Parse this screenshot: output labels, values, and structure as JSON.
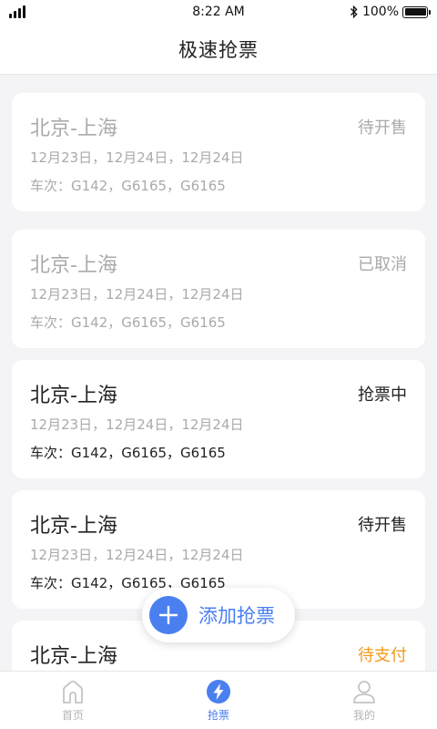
{
  "statusbar": {
    "time": "8:22 AM",
    "battery": "100%"
  },
  "header": {
    "title": "极速抢票"
  },
  "tickets": [
    {
      "route": "北京-上海",
      "status": "待开售",
      "dates": "12月23日，12月24日，12月24日",
      "trains": "车次：G142，G6165，G6165"
    },
    {
      "route": "北京-上海",
      "status": "已取消",
      "dates": "12月23日，12月24日，12月24日",
      "trains": "车次：G142，G6165，G6165"
    },
    {
      "route": "北京-上海",
      "status": "抢票中",
      "dates": "12月23日，12月24日，12月24日",
      "trains": "车次：G142，G6165，G6165"
    },
    {
      "route": "北京-上海",
      "status": "待开售",
      "dates": "12月23日，12月24日，12月24日",
      "trains": "车次：G142，G6165，G6165"
    },
    {
      "route": "北京-上海",
      "status": "待支付"
    }
  ],
  "fab": {
    "label": "添加抢票"
  },
  "tabbar": {
    "items": [
      {
        "label": "首页"
      },
      {
        "label": "抢票"
      },
      {
        "label": "我的"
      }
    ]
  },
  "colors": {
    "accent": "#4a7ff0",
    "pay_status": "#f29b1d",
    "muted_text": "#aaaaaa"
  }
}
